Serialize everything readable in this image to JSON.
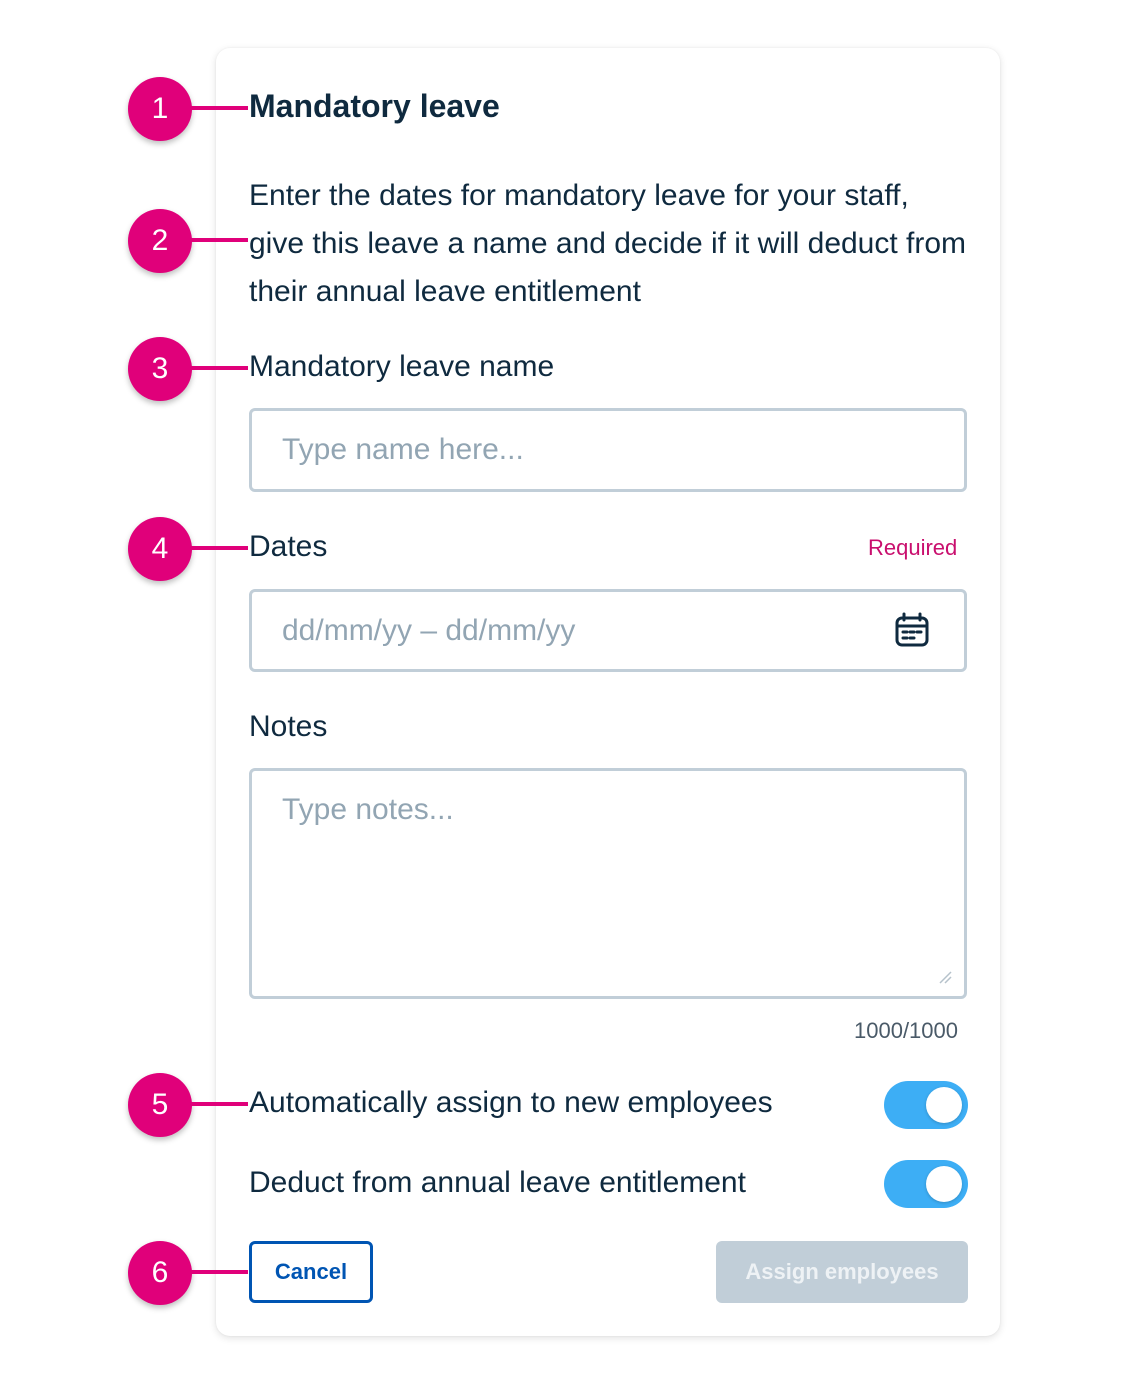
{
  "dialog": {
    "title": "Mandatory leave",
    "description": "Enter the dates for mandatory leave for your staff, give this leave a name and decide if it will deduct from their annual leave entitlement",
    "name_field": {
      "label": "Mandatory leave name",
      "placeholder": "Type name here...",
      "value": ""
    },
    "dates_field": {
      "label": "Dates",
      "required_label": "Required",
      "placeholder": "dd/mm/yy – dd/mm/yy",
      "icon": "calendar-icon",
      "value": ""
    },
    "notes_field": {
      "label": "Notes",
      "placeholder": "Type notes...",
      "counter": "1000/1000",
      "value": ""
    },
    "toggles": [
      {
        "label": "Automatically assign to new employees",
        "on": true
      },
      {
        "label": "Deduct from annual leave entitlement",
        "on": true
      }
    ],
    "buttons": {
      "cancel": "Cancel",
      "assign": "Assign employees"
    }
  },
  "annotations": [
    "1",
    "2",
    "3",
    "4",
    "5",
    "6"
  ],
  "colors": {
    "accent_marker": "#e0007a",
    "toggle_on": "#3daef5",
    "primary_blue": "#0055b3",
    "required": "#c90f6e",
    "disabled_button": "#c1ced8"
  }
}
